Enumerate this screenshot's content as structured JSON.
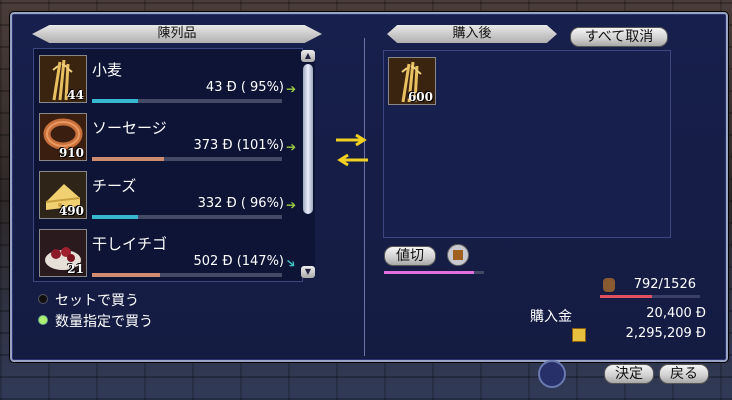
{
  "left_panel": {
    "header": "陳列品"
  },
  "right_panel": {
    "header": "購入後",
    "cancel_all": "すべて取消"
  },
  "items": [
    {
      "name": "小麦",
      "qty": "44",
      "price": "43",
      "pct": "( 95%)",
      "currency": "Đ",
      "bar_fraction": 0.24,
      "bar_color": "#38b8d0"
    },
    {
      "name": "ソーセージ",
      "qty": "910",
      "price": "373",
      "pct": "(101%)",
      "currency": "Đ",
      "bar_fraction": 0.38,
      "bar_color": "#d08c70"
    },
    {
      "name": "チーズ",
      "qty": "490",
      "price": "332",
      "pct": "( 96%)",
      "currency": "Đ",
      "bar_fraction": 0.24,
      "bar_color": "#38b8d0"
    },
    {
      "name": "干しイチゴ",
      "qty": "21",
      "price": "502",
      "pct": "(147%)",
      "currency": "Đ",
      "bar_fraction": 0.36,
      "bar_color": "#d08c70"
    }
  ],
  "purchase": {
    "qty": "600"
  },
  "options": {
    "by_set": "セットで買う",
    "by_qty": "数量指定で買う"
  },
  "haggle": {
    "label": "値切"
  },
  "cargo": {
    "value": "792/1526",
    "fill_fraction": 0.52
  },
  "totals": {
    "purchase_label": "購入金",
    "purchase_value": "20,400",
    "money_value": "2,295,209",
    "currency": "Đ"
  },
  "footer": {
    "confirm": "決定",
    "back": "戻る"
  }
}
